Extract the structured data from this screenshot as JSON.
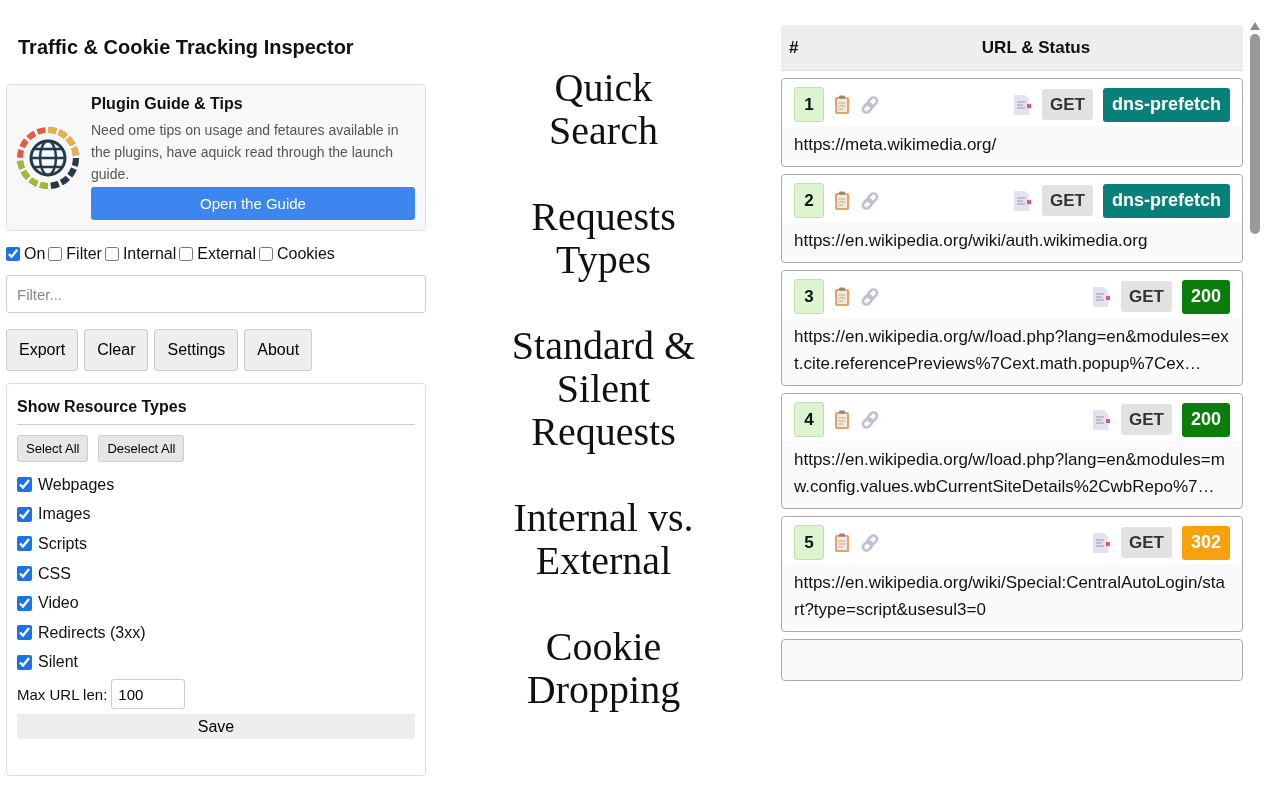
{
  "panel": {
    "title": "Traffic & Cookie Tracking Inspector",
    "guide": {
      "title": "Plugin Guide & Tips",
      "text": "Need ome tips on usage and fetaures available in the plugins, have aquick read through the launch guide.",
      "button": "Open the Guide"
    },
    "toggles": [
      {
        "label": "On",
        "checked": true
      },
      {
        "label": "Filter",
        "checked": false
      },
      {
        "label": "Internal",
        "checked": false
      },
      {
        "label": "External",
        "checked": false
      },
      {
        "label": "Cookies",
        "checked": false
      }
    ],
    "filter": {
      "placeholder": "Filter..."
    },
    "buttons": [
      "Export",
      "Clear",
      "Settings",
      "About"
    ],
    "resource_types": {
      "title": "Show Resource Types",
      "select_all": "Select All",
      "deselect_all": "Deselect All",
      "items": [
        {
          "label": "Webpages",
          "checked": true
        },
        {
          "label": "Images",
          "checked": true
        },
        {
          "label": "Scripts",
          "checked": true
        },
        {
          "label": "CSS",
          "checked": true
        },
        {
          "label": "Video",
          "checked": true
        },
        {
          "label": "Redirects (3xx)",
          "checked": true
        },
        {
          "label": "Silent",
          "checked": true
        }
      ],
      "max_url_label": "Max URL len:",
      "max_url_value": "100",
      "save": "Save"
    }
  },
  "captions": [
    "Quick Search",
    "Requests Types",
    "Standard & Silent Requests",
    "Internal vs. External",
    "Cookie Dropping"
  ],
  "requests": {
    "columns": [
      "#",
      "URL & Status"
    ],
    "rows": [
      {
        "number": "1",
        "method": "GET",
        "status": "dns-prefetch",
        "color": "#08807a",
        "url": "https://meta.wikimedia.org/"
      },
      {
        "number": "2",
        "method": "GET",
        "status": "dns-prefetch",
        "color": "#08807a",
        "url": "https://en.wikipedia.org/wiki/auth.wikimedia.org"
      },
      {
        "number": "3",
        "method": "GET",
        "status": "200",
        "color": "#0b7d0b",
        "url": "https://en.wikipedia.org/w/load.php?lang=en&modules=ext.cite.referencePreviews%7Cext.math.popup%7Cex…"
      },
      {
        "number": "4",
        "method": "GET",
        "status": "200",
        "color": "#0b7d0b",
        "url": "https://en.wikipedia.org/w/load.php?lang=en&modules=mw.config.values.wbCurrentSiteDetails%2CwbRepo%7…"
      },
      {
        "number": "5",
        "method": "GET",
        "status": "302",
        "color": "#f7a20c",
        "url": "https://en.wikipedia.org/wiki/Special:CentralAutoLogin/start?type=script&usesul3=0"
      }
    ]
  }
}
